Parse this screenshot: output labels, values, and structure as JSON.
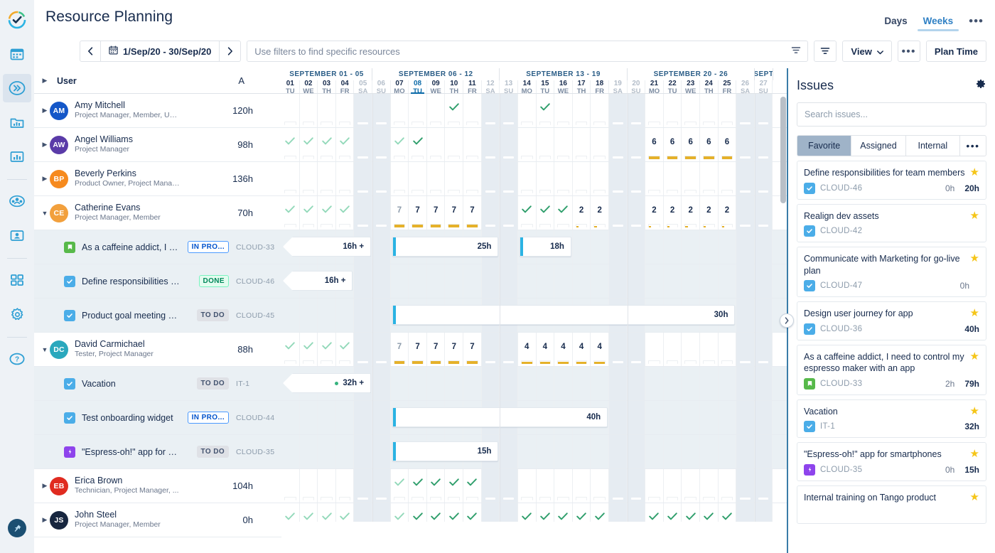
{
  "rail": {
    "items": [
      {
        "name": "logo-icon",
        "label": "Tempo"
      },
      {
        "name": "calendar-icon",
        "label": "Calendar"
      },
      {
        "name": "chevrons-right-icon",
        "label": "Planner"
      },
      {
        "name": "folder-chart-icon",
        "label": "Reports"
      },
      {
        "name": "bar-chart-icon",
        "label": "Analytics"
      },
      {
        "name": "team-icon",
        "label": "Teams"
      },
      {
        "name": "user-card-icon",
        "label": "Accounts"
      },
      {
        "name": "apps-grid-icon",
        "label": "Apps"
      },
      {
        "name": "gear-icon",
        "label": "Settings"
      },
      {
        "name": "help-icon",
        "label": "Help"
      },
      {
        "name": "pin-icon",
        "label": "Pin"
      }
    ]
  },
  "header": {
    "title": "Resource Planning",
    "tabs": [
      {
        "label": "Days",
        "active": false
      },
      {
        "label": "Weeks",
        "active": true
      }
    ],
    "more_label": "•••"
  },
  "toolbar": {
    "prev_label": "‹",
    "next_label": "›",
    "date_range": "1/Sep/20 - 30/Sep/20",
    "filter_placeholder": "Use filters to find specific resources",
    "filter_value": "",
    "view_label": "View",
    "more_label": "•••",
    "plan_time_label": "Plan Time"
  },
  "grid": {
    "columns": {
      "caret_label": "▶",
      "user_label": "User",
      "a_label": "A"
    },
    "weeks": [
      {
        "label": "SEPTEMBER 01 - 05",
        "days": 5
      },
      {
        "label": "SEPTEMBER 06 - 12",
        "days": 7
      },
      {
        "label": "SEPTEMBER 13 - 19",
        "days": 7
      },
      {
        "label": "SEPTEMBER 20 - 26",
        "days": 7
      },
      {
        "label": "SEPT",
        "days": 1
      }
    ],
    "days": [
      {
        "d": "01",
        "w": "TU",
        "weekend": false,
        "today": false
      },
      {
        "d": "02",
        "w": "WE",
        "weekend": false,
        "today": false
      },
      {
        "d": "03",
        "w": "TH",
        "weekend": false,
        "today": false
      },
      {
        "d": "04",
        "w": "FR",
        "weekend": false,
        "today": false
      },
      {
        "d": "05",
        "w": "SA",
        "weekend": true,
        "today": false
      },
      {
        "d": "06",
        "w": "SU",
        "weekend": true,
        "today": false
      },
      {
        "d": "07",
        "w": "MO",
        "weekend": false,
        "today": false
      },
      {
        "d": "08",
        "w": "TU",
        "weekend": false,
        "today": true
      },
      {
        "d": "09",
        "w": "WE",
        "weekend": false,
        "today": false
      },
      {
        "d": "10",
        "w": "TH",
        "weekend": false,
        "today": false
      },
      {
        "d": "11",
        "w": "FR",
        "weekend": false,
        "today": false
      },
      {
        "d": "12",
        "w": "SA",
        "weekend": true,
        "today": false
      },
      {
        "d": "13",
        "w": "SU",
        "weekend": true,
        "today": false
      },
      {
        "d": "14",
        "w": "MO",
        "weekend": false,
        "today": false
      },
      {
        "d": "15",
        "w": "TU",
        "weekend": false,
        "today": false
      },
      {
        "d": "16",
        "w": "WE",
        "weekend": false,
        "today": false
      },
      {
        "d": "17",
        "w": "TH",
        "weekend": false,
        "today": false
      },
      {
        "d": "18",
        "w": "FR",
        "weekend": false,
        "today": false
      },
      {
        "d": "19",
        "w": "SA",
        "weekend": true,
        "today": false
      },
      {
        "d": "20",
        "w": "SU",
        "weekend": true,
        "today": false
      },
      {
        "d": "21",
        "w": "MO",
        "weekend": false,
        "today": false
      },
      {
        "d": "22",
        "w": "TU",
        "weekend": false,
        "today": false
      },
      {
        "d": "23",
        "w": "WE",
        "weekend": false,
        "today": false
      },
      {
        "d": "24",
        "w": "TH",
        "weekend": false,
        "today": false
      },
      {
        "d": "25",
        "w": "FR",
        "weekend": false,
        "today": false
      },
      {
        "d": "26",
        "w": "SA",
        "weekend": true,
        "today": false
      },
      {
        "d": "27",
        "w": "SU",
        "weekend": true,
        "today": false
      }
    ],
    "rows": [
      {
        "kind": "user",
        "expanded": false,
        "initials": "AM",
        "color": "#1457c8",
        "name": "Amy Mitchell",
        "role": "Project Manager, Member, UX ...",
        "hours": "120h",
        "cells": [
          {
            "i": 9,
            "check": true,
            "dim": false
          },
          {
            "i": 14,
            "check": true,
            "dim": false
          }
        ]
      },
      {
        "kind": "user",
        "expanded": false,
        "initials": "AW",
        "color": "#5a3ba8",
        "name": "Angel Williams",
        "role": "Project Manager",
        "hours": "98h",
        "cells": [
          {
            "i": 0,
            "check": true,
            "dim": true
          },
          {
            "i": 1,
            "check": true,
            "dim": true
          },
          {
            "i": 2,
            "check": true,
            "dim": true
          },
          {
            "i": 3,
            "check": true,
            "dim": true
          },
          {
            "i": 6,
            "check": true,
            "dim": true
          },
          {
            "i": 7,
            "check": true,
            "dim": false
          },
          {
            "i": 20,
            "value": "6",
            "fill": 0.75
          },
          {
            "i": 21,
            "value": "6",
            "fill": 0.75
          },
          {
            "i": 22,
            "value": "6",
            "fill": 0.75
          },
          {
            "i": 23,
            "value": "6",
            "fill": 0.75
          },
          {
            "i": 24,
            "value": "6",
            "fill": 0.75
          }
        ]
      },
      {
        "kind": "user",
        "expanded": false,
        "initials": "BP",
        "color": "#f68a1e",
        "name": "Beverly Perkins",
        "role": "Product Owner, Project Manag...",
        "hours": "136h",
        "cells": []
      },
      {
        "kind": "user",
        "expanded": true,
        "initials": "CE",
        "color": "#f2a03d",
        "name": "Catherine Evans",
        "role": "Project Manager, Member",
        "hours": "70h",
        "cells": [
          {
            "i": 0,
            "check": true,
            "dim": true
          },
          {
            "i": 1,
            "check": true,
            "dim": true
          },
          {
            "i": 2,
            "check": true,
            "dim": true
          },
          {
            "i": 3,
            "check": true,
            "dim": true
          },
          {
            "i": 6,
            "value": "7",
            "dim": true,
            "fill": 0.88
          },
          {
            "i": 7,
            "value": "7",
            "fill": 0.88
          },
          {
            "i": 8,
            "value": "7",
            "fill": 0.88
          },
          {
            "i": 9,
            "value": "7",
            "fill": 0.88
          },
          {
            "i": 10,
            "value": "7",
            "fill": 0.88
          },
          {
            "i": 13,
            "check": true,
            "dim": false
          },
          {
            "i": 14,
            "check": true,
            "dim": false
          },
          {
            "i": 15,
            "check": true,
            "dim": false
          },
          {
            "i": 16,
            "value": "2",
            "fill": 0.25
          },
          {
            "i": 17,
            "value": "2",
            "fill": 0.25
          },
          {
            "i": 20,
            "value": "2",
            "fill": 0.25
          },
          {
            "i": 21,
            "value": "2",
            "fill": 0.25
          },
          {
            "i": 22,
            "value": "2",
            "fill": 0.25
          },
          {
            "i": 23,
            "value": "2",
            "fill": 0.25
          },
          {
            "i": 24,
            "value": "2",
            "fill": 0.25
          }
        ]
      },
      {
        "kind": "issue",
        "icon": "story-icon",
        "icon_color": "#57b94a",
        "title": "As a caffeine addict, I need ...",
        "status": "IN PRO...",
        "status_kind": "prog",
        "key": "CLOUD-33",
        "bars": [
          {
            "start": 0,
            "end": 5,
            "label": "16h +",
            "cont": true,
            "edge": false,
            "dot": false
          },
          {
            "start": 6,
            "end": 12,
            "label": "25h",
            "cont": false,
            "edge": true,
            "dot": false
          },
          {
            "start": 13,
            "end": 16,
            "label": "18h",
            "cont": false,
            "edge": true,
            "dot": false
          }
        ]
      },
      {
        "kind": "issue",
        "icon": "task-icon",
        "icon_color": "#4bade8",
        "title": "Define responsibilities for te...",
        "status": "DONE",
        "status_kind": "done",
        "key": "CLOUD-46",
        "bars": [
          {
            "start": 0,
            "end": 4,
            "label": "16h +",
            "cont": true,
            "edge": false,
            "dot": false
          }
        ]
      },
      {
        "kind": "issue",
        "icon": "task-icon",
        "icon_color": "#4bade8",
        "title": "Product goal meeting and d...",
        "status": "TO DO",
        "status_kind": "todo",
        "key": "CLOUD-45",
        "bars": [
          {
            "start": 6,
            "end": 25,
            "label": "30h",
            "cont": false,
            "edge": true,
            "dot": false
          }
        ]
      },
      {
        "kind": "user",
        "expanded": true,
        "initials": "DC",
        "color": "#2aa8bd",
        "name": "David Carmichael",
        "role": "Tester, Project Manager",
        "hours": "88h",
        "cells": [
          {
            "i": 0,
            "check": true,
            "dim": true
          },
          {
            "i": 1,
            "check": true,
            "dim": true
          },
          {
            "i": 2,
            "check": true,
            "dim": true
          },
          {
            "i": 3,
            "check": true,
            "dim": true
          },
          {
            "i": 6,
            "value": "7",
            "dim": true,
            "fill": 0.88
          },
          {
            "i": 7,
            "value": "7",
            "fill": 0.88
          },
          {
            "i": 8,
            "value": "7",
            "fill": 0.88
          },
          {
            "i": 9,
            "value": "7",
            "fill": 0.88
          },
          {
            "i": 10,
            "value": "7",
            "fill": 0.88
          },
          {
            "i": 13,
            "value": "4",
            "fill": 0.5
          },
          {
            "i": 14,
            "value": "4",
            "fill": 0.5
          },
          {
            "i": 15,
            "value": "4",
            "fill": 0.5
          },
          {
            "i": 16,
            "value": "4",
            "fill": 0.5
          },
          {
            "i": 17,
            "value": "4",
            "fill": 0.5
          }
        ]
      },
      {
        "kind": "issue",
        "icon": "task-icon",
        "icon_color": "#4bade8",
        "title": "Vacation",
        "status": "TO DO",
        "status_kind": "todo",
        "key": "IT-1",
        "bars": [
          {
            "start": 0,
            "end": 5,
            "label": "32h +",
            "cont": true,
            "edge": false,
            "dot": true
          }
        ]
      },
      {
        "kind": "issue",
        "icon": "task-icon",
        "icon_color": "#4bade8",
        "title": "Test onboarding widget",
        "status": "IN PRO...",
        "status_kind": "prog",
        "key": "CLOUD-44",
        "bars": [
          {
            "start": 6,
            "end": 18,
            "label": "40h",
            "cont": false,
            "edge": true,
            "dot": false
          }
        ]
      },
      {
        "kind": "issue",
        "icon": "bug-icon",
        "icon_color": "#8e44ec",
        "title": "\"Espress-oh!\" app for smart...",
        "status": "TO DO",
        "status_kind": "todo",
        "key": "CLOUD-35",
        "bars": [
          {
            "start": 6,
            "end": 12,
            "label": "15h",
            "cont": false,
            "edge": true,
            "dot": false
          }
        ]
      },
      {
        "kind": "user",
        "expanded": false,
        "initials": "EB",
        "color": "#e02b20",
        "name": "Erica Brown",
        "role": "Technician, Project Manager, ...",
        "hours": "104h",
        "cells": [
          {
            "i": 6,
            "check": true,
            "dim": true
          },
          {
            "i": 7,
            "check": true,
            "dim": false
          },
          {
            "i": 8,
            "check": true,
            "dim": false
          },
          {
            "i": 9,
            "check": true,
            "dim": false
          },
          {
            "i": 10,
            "check": true,
            "dim": false
          }
        ]
      },
      {
        "kind": "user",
        "expanded": false,
        "initials": "JS",
        "color": "#17263f",
        "name": "John Steel",
        "role": "Project Manager, Member",
        "hours": "0h",
        "cells": [
          {
            "i": 0,
            "check": true,
            "dim": true
          },
          {
            "i": 1,
            "check": true,
            "dim": true
          },
          {
            "i": 2,
            "check": true,
            "dim": true
          },
          {
            "i": 3,
            "check": true,
            "dim": true
          },
          {
            "i": 6,
            "check": true,
            "dim": true
          },
          {
            "i": 7,
            "check": true,
            "dim": false
          },
          {
            "i": 8,
            "check": true,
            "dim": false
          },
          {
            "i": 9,
            "check": true,
            "dim": false
          },
          {
            "i": 10,
            "check": true,
            "dim": false
          },
          {
            "i": 13,
            "check": true,
            "dim": false
          },
          {
            "i": 14,
            "check": true,
            "dim": false
          },
          {
            "i": 15,
            "check": true,
            "dim": false
          },
          {
            "i": 16,
            "check": true,
            "dim": false
          },
          {
            "i": 17,
            "check": true,
            "dim": false
          },
          {
            "i": 20,
            "check": true,
            "dim": false
          },
          {
            "i": 21,
            "check": true,
            "dim": false
          },
          {
            "i": 22,
            "check": true,
            "dim": false
          },
          {
            "i": 23,
            "check": true,
            "dim": false
          },
          {
            "i": 24,
            "check": true,
            "dim": false
          }
        ]
      }
    ]
  },
  "issues_panel": {
    "title": "Issues",
    "search_placeholder": "Search issues...",
    "search_value": "",
    "tabs": [
      {
        "label": "Favorite",
        "active": true
      },
      {
        "label": "Assigned",
        "active": false
      },
      {
        "label": "Internal",
        "active": false
      },
      {
        "label": "•••",
        "active": false
      }
    ],
    "items": [
      {
        "title": "Define responsibilities for team members",
        "icon": "task-icon",
        "icon_color": "#4bade8",
        "key": "CLOUD-46",
        "logged": "0h",
        "estimate": "20h",
        "starred": true
      },
      {
        "title": "Realign dev assets",
        "icon": "task-icon",
        "icon_color": "#4bade8",
        "key": "CLOUD-42",
        "logged": "",
        "estimate": "",
        "starred": true
      },
      {
        "title": "Communicate with Marketing for go-live plan",
        "icon": "task-icon",
        "icon_color": "#4bade8",
        "key": "CLOUD-47",
        "logged": "0h",
        "estimate": "",
        "starred": true
      },
      {
        "title": "Design user journey for app",
        "icon": "task-icon",
        "icon_color": "#4bade8",
        "key": "CLOUD-36",
        "logged": "",
        "estimate": "40h",
        "starred": true
      },
      {
        "title": "As a caffeine addict, I need to control my espresso maker with an app",
        "icon": "story-icon",
        "icon_color": "#57b94a",
        "key": "CLOUD-33",
        "logged": "2h",
        "estimate": "79h",
        "starred": true
      },
      {
        "title": "Vacation",
        "icon": "task-icon",
        "icon_color": "#4bade8",
        "key": "IT-1",
        "logged": "",
        "estimate": "32h",
        "starred": true
      },
      {
        "title": "\"Espress-oh!\" app for smartphones",
        "icon": "bug-icon",
        "icon_color": "#8e44ec",
        "key": "CLOUD-35",
        "logged": "0h",
        "estimate": "15h",
        "starred": true
      },
      {
        "title": "Internal training on Tango product",
        "icon": "task-icon",
        "icon_color": "#4bade8",
        "key": "",
        "logged": "",
        "estimate": "",
        "starred": true
      }
    ]
  },
  "colors": {
    "accent": "#0b6aa8",
    "divider": "#3a7ca8",
    "capacity_bar": "#e5b12a",
    "check": "#2e9e6b",
    "star": "#f5c518"
  }
}
